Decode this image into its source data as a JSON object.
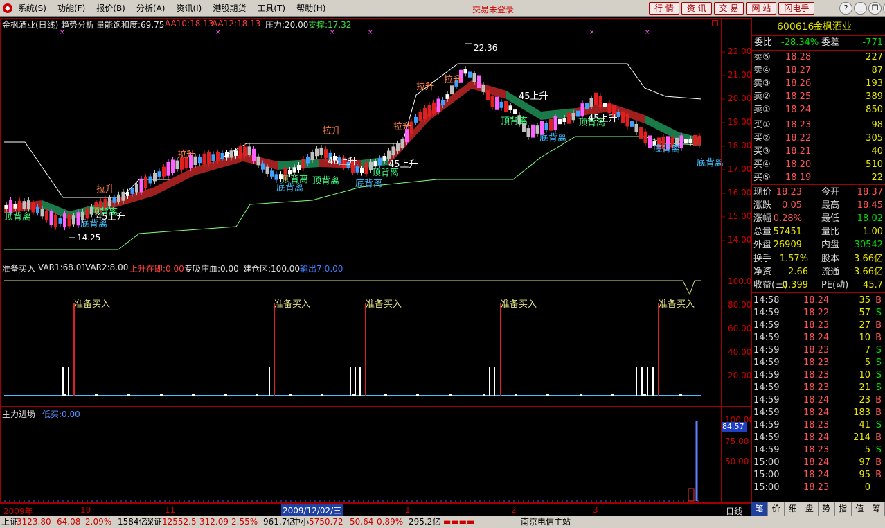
{
  "menu": {
    "items": [
      "系统(S)",
      "功能(F)",
      "报价(B)",
      "分析(A)",
      "资讯(I)",
      "港股期货",
      "工具(T)",
      "帮助(H)"
    ],
    "login_status": "交易未登录",
    "buttons": [
      "行 情",
      "资 讯",
      "交 易",
      "网 站",
      "闪电手"
    ]
  },
  "main": {
    "title": "金枫酒业(日线)",
    "indicator": "趋势分析",
    "volume_label": "量能饱和度:69.75",
    "aa10": "AA10:18.13",
    "aa12": "AA12:18.13",
    "pressure": "压力:20.00",
    "support": "支撑:17.32",
    "y_ticks": [
      "22.00",
      "21.00",
      "20.00",
      "19.00",
      "18.00",
      "17.00",
      "16.00",
      "15.00",
      "14.00"
    ],
    "high_mark": "22.36",
    "low_mark": "14.25",
    "annotations": [
      "顶背离",
      "底背离",
      "拉升",
      "45上升"
    ]
  },
  "sub1": {
    "name": "准备买入",
    "var1": "VAR1:68.01",
    "var2": "VAR2:8.00",
    "rise": "上升在即:0.00",
    "absorb": "专吸庄血:0.00",
    "build": "建仓区:100.00",
    "out": "输出7:0.00",
    "y_ticks": [
      "100.00",
      "80.00",
      "60.00",
      "40.00",
      "20.00"
    ],
    "signal": "准备买入"
  },
  "sub2": {
    "name": "主力进场",
    "low": "低买:0.00",
    "y_ticks": [
      "100.00",
      "75.00",
      "50.00"
    ],
    "value": "84.57"
  },
  "xaxis": {
    "labels": [
      "2009年",
      "10",
      "11",
      "2009/12/02/三",
      "1",
      "2",
      "3"
    ],
    "period": "日线"
  },
  "quote": {
    "code": "600616",
    "name": "金枫酒业",
    "wb_label": "委比",
    "wb": "-28.34%",
    "wc_label": "委差",
    "wc": "-771",
    "asks": [
      {
        "l": "卖⑤",
        "p": "18.28",
        "v": "227"
      },
      {
        "l": "卖④",
        "p": "18.27",
        "v": "87"
      },
      {
        "l": "卖③",
        "p": "18.26",
        "v": "193"
      },
      {
        "l": "卖②",
        "p": "18.25",
        "v": "389"
      },
      {
        "l": "卖①",
        "p": "18.24",
        "v": "850"
      }
    ],
    "bids": [
      {
        "l": "买①",
        "p": "18.23",
        "v": "98"
      },
      {
        "l": "买②",
        "p": "18.22",
        "v": "305"
      },
      {
        "l": "买③",
        "p": "18.21",
        "v": "40"
      },
      {
        "l": "买④",
        "p": "18.20",
        "v": "510"
      },
      {
        "l": "买⑤",
        "p": "18.19",
        "v": "22"
      }
    ],
    "stats": [
      [
        "现价",
        "18.23",
        "今开",
        "18.37"
      ],
      [
        "涨跌",
        "0.05",
        "最高",
        "18.45"
      ],
      [
        "涨幅",
        "0.28%",
        "最低",
        "18.02"
      ],
      [
        "总量",
        "57451",
        "量比",
        "1.00"
      ],
      [
        "外盘",
        "26909",
        "内盘",
        "30542"
      ]
    ],
    "stats2": [
      [
        "换手",
        "1.57%",
        "股本",
        "3.66亿"
      ],
      [
        "净资",
        "2.66",
        "流通",
        "3.66亿"
      ],
      [
        "收益(三)",
        "0.399",
        "PE(动)",
        "45.7"
      ]
    ],
    "ticks": [
      [
        "14:58",
        "18.24",
        "35",
        "B"
      ],
      [
        "14:59",
        "18.22",
        "57",
        "S"
      ],
      [
        "14:59",
        "18.23",
        "27",
        "B"
      ],
      [
        "14:59",
        "18.24",
        "10",
        "B"
      ],
      [
        "14:59",
        "18.23",
        "7",
        "S"
      ],
      [
        "14:59",
        "18.23",
        "5",
        "S"
      ],
      [
        "14:59",
        "18.23",
        "10",
        "S"
      ],
      [
        "14:59",
        "18.23",
        "21",
        "S"
      ],
      [
        "14:59",
        "18.24",
        "23",
        "B"
      ],
      [
        "14:59",
        "18.24",
        "183",
        "B"
      ],
      [
        "14:59",
        "18.23",
        "41",
        "S"
      ],
      [
        "14:59",
        "18.24",
        "214",
        "B"
      ],
      [
        "14:59",
        "18.23",
        "5",
        "S"
      ],
      [
        "15:00",
        "18.24",
        "97",
        "B"
      ],
      [
        "15:00",
        "18.24",
        "95",
        "B"
      ],
      [
        "15:00",
        "18.23",
        "0",
        ""
      ]
    ],
    "tabs": [
      "笔",
      "价",
      "细",
      "盘",
      "势",
      "指",
      "值",
      "筹"
    ]
  },
  "status": {
    "sh_label": "上证",
    "sh": "3123.80",
    "sh_chg": "64.08",
    "sh_pct": "2.09%",
    "sh_amt": "1584亿",
    "sz_label": "深证",
    "sz": "12552.5",
    "sz_chg": "312.09",
    "sz_pct": "2.55%",
    "sz_amt": "961.7亿",
    "zx_label": "中小",
    "zx": "5750.72",
    "zx_chg": "50.64",
    "zx_pct": "0.89%",
    "zx_amt": "295.2亿",
    "server": "南京电信主站"
  }
}
